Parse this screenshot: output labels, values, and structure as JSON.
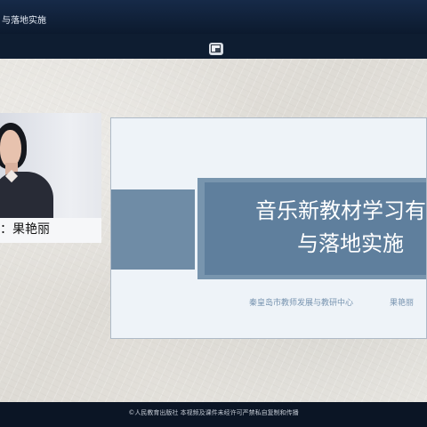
{
  "window": {
    "title": "与落地实施"
  },
  "speaker": {
    "label": "：果艳丽"
  },
  "slide": {
    "title_line_1": "音乐新教材学习有",
    "title_line_2": "与落地实施",
    "organization": "秦皇岛市教师发展与教研中心",
    "presenter": "果艳丽"
  },
  "footer": {
    "copyright": "©人民教育出版社 本视频及课件未经许可严禁私自复制和传播"
  },
  "icons": {
    "picture_in_picture": "picture-in-picture-icon"
  },
  "colors": {
    "title_bar": "#162a48",
    "slide_banner": "#5f7f9d",
    "slide_text": "#7894b0"
  }
}
